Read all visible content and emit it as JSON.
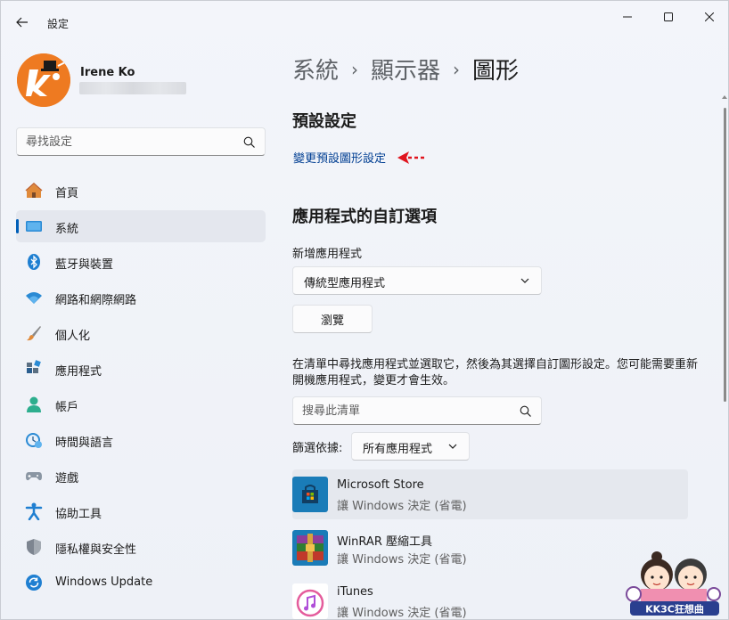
{
  "window": {
    "title": "設定"
  },
  "profile": {
    "name": "Irene Ko"
  },
  "search": {
    "placeholder": "尋找設定"
  },
  "nav": {
    "items": [
      {
        "label": "首頁",
        "icon": "home-icon"
      },
      {
        "label": "系統",
        "icon": "system-icon",
        "active": true
      },
      {
        "label": "藍牙與裝置",
        "icon": "bluetooth-icon"
      },
      {
        "label": "網路和網際網路",
        "icon": "wifi-icon"
      },
      {
        "label": "個人化",
        "icon": "brush-icon"
      },
      {
        "label": "應用程式",
        "icon": "apps-icon"
      },
      {
        "label": "帳戶",
        "icon": "account-icon"
      },
      {
        "label": "時間與語言",
        "icon": "clock-globe-icon"
      },
      {
        "label": "遊戲",
        "icon": "gamepad-icon"
      },
      {
        "label": "協助工具",
        "icon": "accessibility-icon"
      },
      {
        "label": "隱私權與安全性",
        "icon": "shield-icon"
      },
      {
        "label": "Windows Update",
        "icon": "update-icon"
      }
    ]
  },
  "breadcrumb": {
    "part1": "系統",
    "part2": "顯示器",
    "current": "圖形"
  },
  "defaults": {
    "heading": "預設設定",
    "link": "變更預設圖形設定"
  },
  "custom": {
    "heading": "應用程式的自訂選項",
    "add_label": "新增應用程式",
    "app_type": "傳統型應用程式",
    "browse": "瀏覽",
    "description": "在清單中尋找應用程式並選取它，然後為其選擇自訂圖形設定。您可能需要重新開機應用程式，變更才會生效。",
    "list_search_placeholder": "搜尋此清單",
    "filter_label": "篩選依據:",
    "filter_value": "所有應用程式"
  },
  "apps": [
    {
      "name": "Microsoft Store",
      "sub": "讓 Windows 決定 (省電)"
    },
    {
      "name": "WinRAR 壓縮工具",
      "sub": "讓 Windows 決定 (省電)"
    },
    {
      "name": "iTunes",
      "sub": "讓 Windows 決定 (省電)"
    }
  ],
  "watermark": {
    "text": "KK3C狂想曲"
  },
  "colors": {
    "accent": "#005fb8",
    "link": "#003e92",
    "annotation": "#e0141e"
  }
}
